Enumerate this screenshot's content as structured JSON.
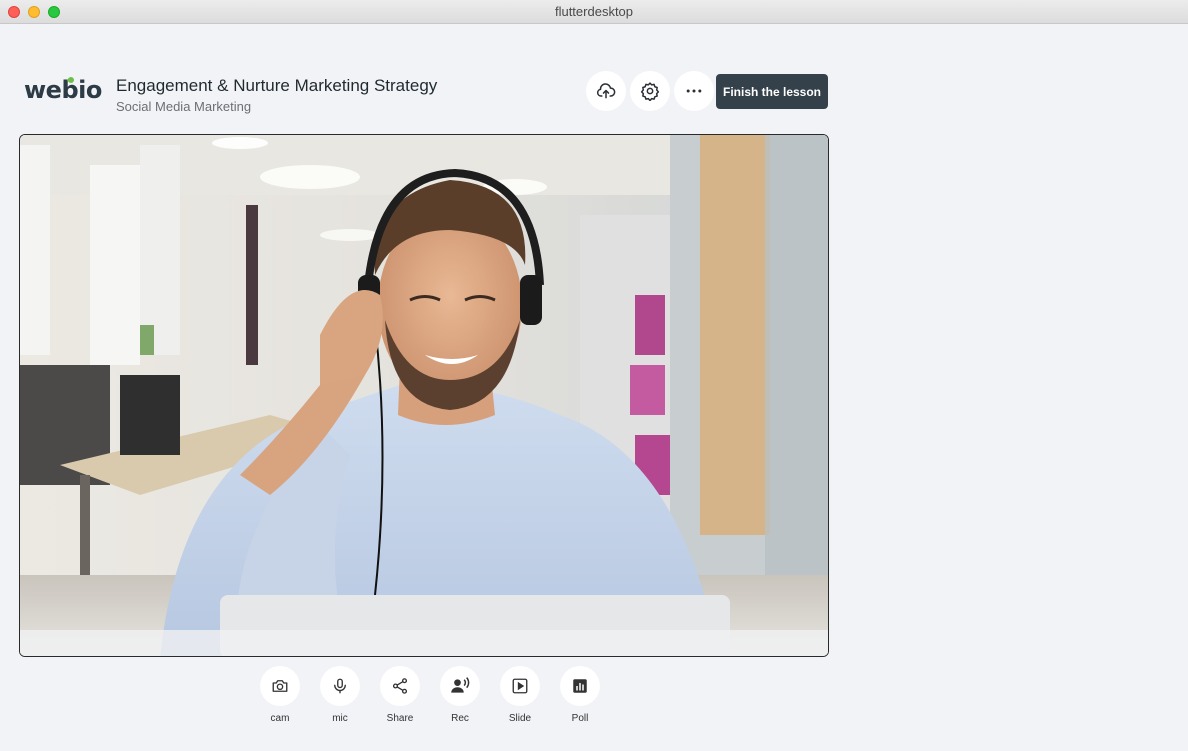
{
  "window": {
    "title": "flutterdesktop"
  },
  "brand": {
    "logo_text": "webio",
    "accent": "#6cc04a"
  },
  "lesson": {
    "title": "Engagement & Nurture Marketing Strategy",
    "subtitle": "Social Media Marketing"
  },
  "toolbar": {
    "upload_icon": "cloud-upload-icon",
    "settings_icon": "gear-icon",
    "more_icon": "more-horizontal-icon",
    "finish_label": "Finish the lesson"
  },
  "video": {
    "description_icon": "video-feed"
  },
  "controls": [
    {
      "label": "cam",
      "icon": "camera-icon"
    },
    {
      "label": "mic",
      "icon": "microphone-icon"
    },
    {
      "label": "Share",
      "icon": "share-icon"
    },
    {
      "label": "Rec",
      "icon": "record-speaker-icon"
    },
    {
      "label": "Slide",
      "icon": "slide-play-icon"
    },
    {
      "label": "Poll",
      "icon": "poll-chart-icon"
    }
  ]
}
